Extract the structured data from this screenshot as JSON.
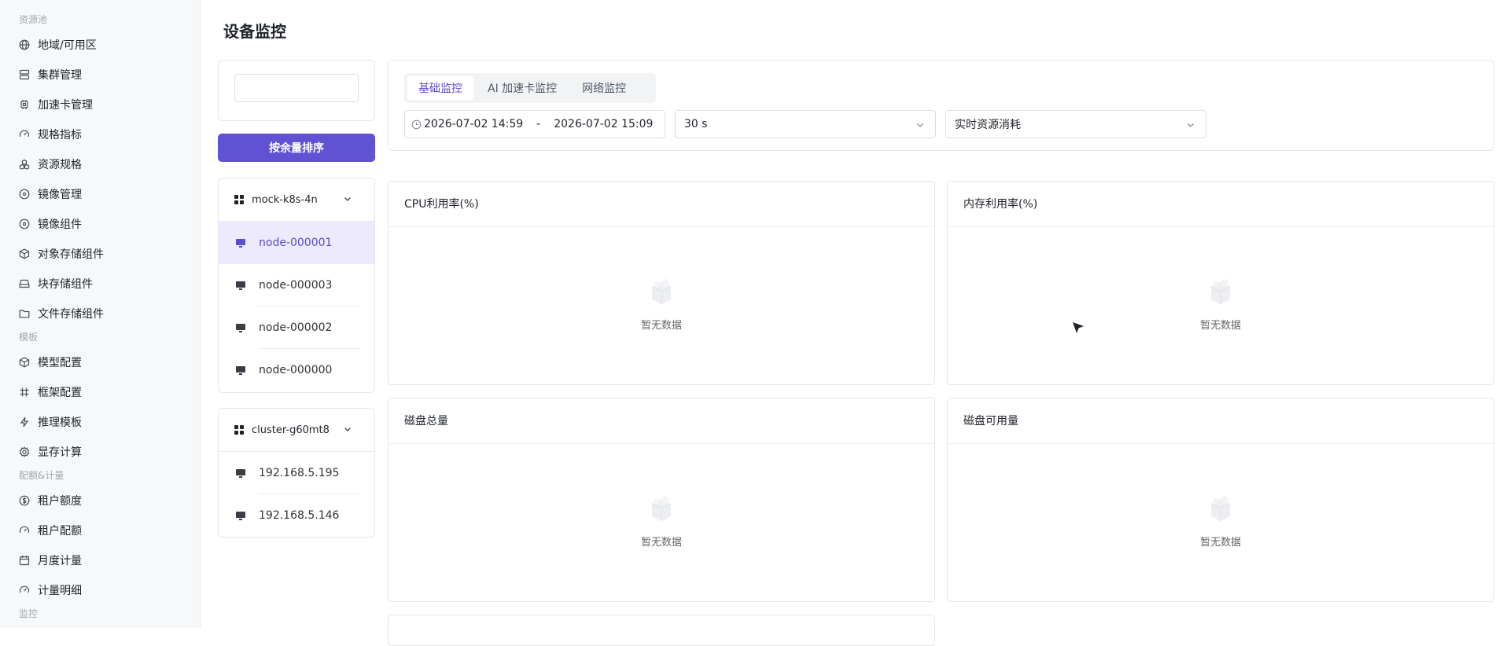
{
  "sidebar": {
    "group_resources": "资源池",
    "resources": [
      {
        "label": "地域/可用区",
        "icon": "globe-icon"
      },
      {
        "label": "集群管理",
        "icon": "server-icon"
      },
      {
        "label": "加速卡管理",
        "icon": "chip-icon"
      },
      {
        "label": "规格指标",
        "icon": "gauge-icon"
      },
      {
        "label": "资源规格",
        "icon": "cubes-icon"
      },
      {
        "label": "镜像管理",
        "icon": "disc-icon"
      },
      {
        "label": "镜像组件",
        "icon": "disc-icon"
      },
      {
        "label": "对象存储组件",
        "icon": "box-icon"
      },
      {
        "label": "块存储组件",
        "icon": "drive-icon"
      },
      {
        "label": "文件存储组件",
        "icon": "folder-icon"
      }
    ],
    "group_template": "模板",
    "templates": [
      {
        "label": "模型配置",
        "icon": "box-icon"
      },
      {
        "label": "框架配置",
        "icon": "hash-icon"
      },
      {
        "label": "推理模板",
        "icon": "bolt-icon"
      },
      {
        "label": "显存计算",
        "icon": "gear-icon"
      }
    ],
    "group_quota": "配额&计量",
    "quotas": [
      {
        "label": "租户额度",
        "icon": "coin-icon"
      },
      {
        "label": "租户配额",
        "icon": "gauge-icon"
      },
      {
        "label": "月度计量",
        "icon": "calendar-icon"
      },
      {
        "label": "计量明细",
        "icon": "gauge-icon"
      }
    ],
    "group_monitor": "监控"
  },
  "page": {
    "title": "设备监控",
    "search_value": "",
    "sort_button": "按余量排序"
  },
  "clusters": [
    {
      "name": "mock-k8s-4n",
      "nodes": [
        "node-000001",
        "node-000003",
        "node-000002",
        "node-000000"
      ],
      "active": "node-000001"
    },
    {
      "name": "cluster-g60mt8",
      "nodes": [
        "192.168.5.195",
        "192.168.5.146"
      ]
    }
  ],
  "filters": {
    "tabs": [
      "基础监控",
      "AI 加速卡监控",
      "网络监控"
    ],
    "active_tab": "基础监控",
    "start_time": "2026-07-02 14:59",
    "range_sep": "-",
    "end_time": "2026-07-02 15:09",
    "interval": "30 s",
    "metric_mode": "实时资源消耗"
  },
  "charts": [
    {
      "title": "CPU利用率(%)",
      "empty_text": "暂无数据"
    },
    {
      "title": "内存利用率(%)",
      "empty_text": "暂无数据"
    },
    {
      "title": "磁盘总量",
      "empty_text": "暂无数据"
    },
    {
      "title": "磁盘可用量",
      "empty_text": "暂无数据"
    }
  ],
  "colors": {
    "accent": "#6152d4",
    "active_bg": "#eceafc"
  }
}
